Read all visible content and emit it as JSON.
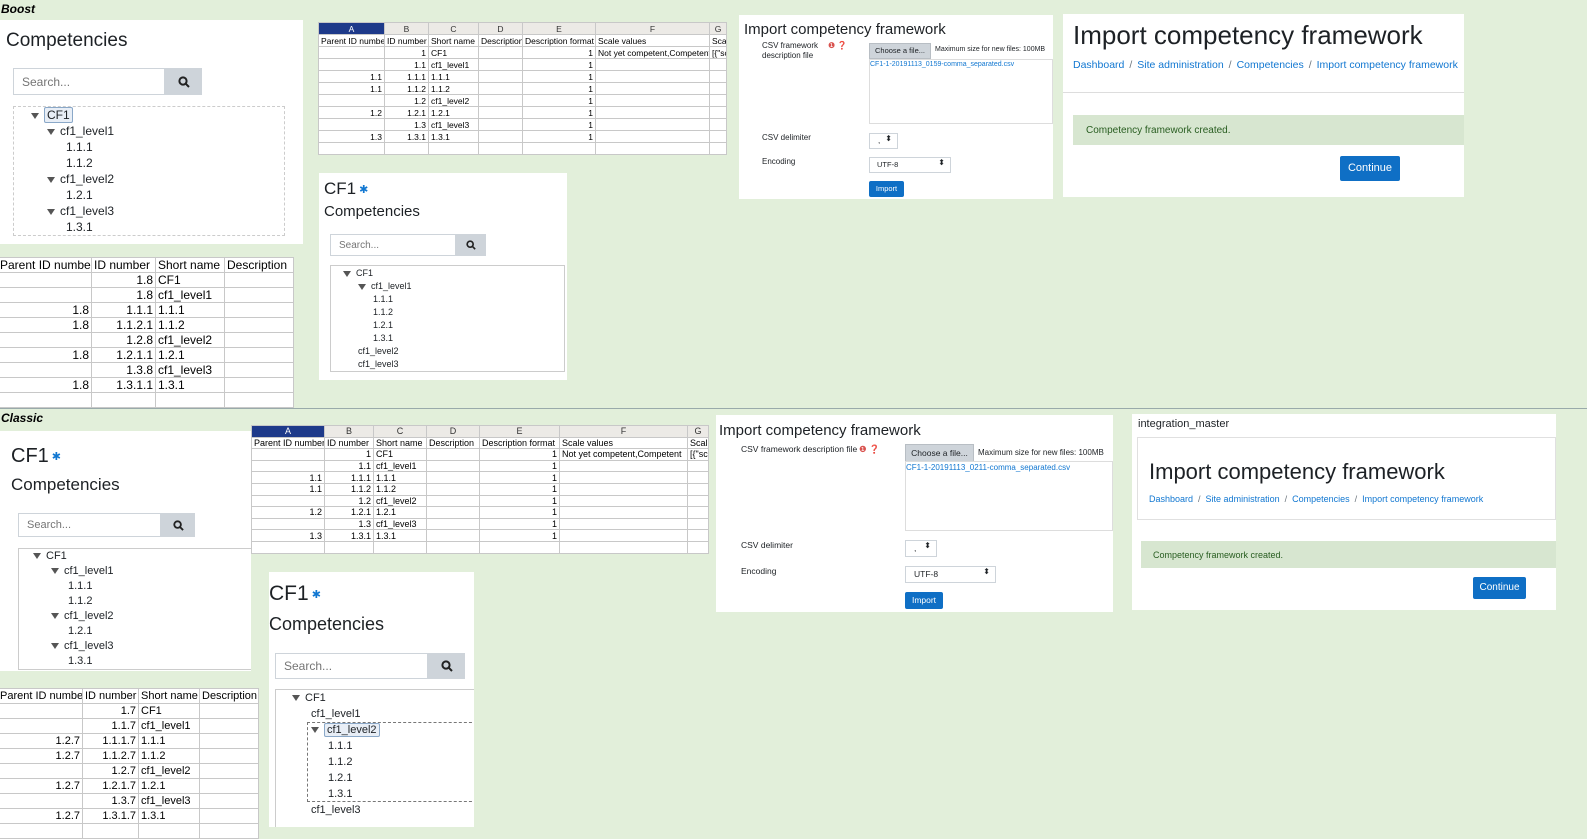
{
  "themes": {
    "boost": "Boost",
    "classic": "Classic"
  },
  "search_placeholder": "Search...",
  "icons": {
    "search": "search-icon",
    "gear": "gear-icon",
    "collapse": "caret-down-icon"
  },
  "boost_tree": {
    "title": "Competencies",
    "nodes": [
      "CF1",
      "cf1_level1",
      "1.1.1",
      "1.1.2",
      "cf1_level2",
      "1.2.1",
      "cf1_level3",
      "1.3.1"
    ]
  },
  "boost_tree2": {
    "framework": "CF1",
    "title": "Competencies",
    "nodes": [
      "CF1",
      "cf1_level1",
      "1.1.1",
      "1.1.2",
      "1.2.1",
      "1.3.1",
      "cf1_level2",
      "cf1_level3"
    ]
  },
  "classic_tree": {
    "framework": "CF1",
    "title": "Competencies",
    "nodes": [
      "CF1",
      "cf1_level1",
      "1.1.1",
      "1.1.2",
      "cf1_level2",
      "1.2.1",
      "cf1_level3",
      "1.3.1"
    ]
  },
  "classic_tree2": {
    "framework": "CF1",
    "title": "Competencies",
    "nodes": [
      "CF1",
      "cf1_level1",
      "cf1_level2",
      "1.1.1",
      "1.1.2",
      "1.2.1",
      "1.3.1",
      "cf1_level3"
    ]
  },
  "sheet_boost": {
    "col_letters": [
      "A",
      "B",
      "C",
      "D",
      "E",
      "F",
      "G"
    ],
    "headers": [
      "Parent ID number",
      "ID number",
      "Short name",
      "Description",
      "Description format",
      "Scale values",
      "Scal"
    ],
    "rows": [
      [
        "",
        "1",
        "CF1",
        "",
        "1",
        "Not yet competent,Competent",
        "[{\"sc"
      ],
      [
        "",
        "1.1",
        "cf1_level1",
        "",
        "1",
        "",
        ""
      ],
      [
        "1.1",
        "1.1.1",
        "1.1.1",
        "",
        "1",
        "",
        ""
      ],
      [
        "1.1",
        "1.1.2",
        "1.1.2",
        "",
        "1",
        "",
        ""
      ],
      [
        "",
        "1.2",
        "cf1_level2",
        "",
        "1",
        "",
        ""
      ],
      [
        "1.2",
        "1.2.1",
        "1.2.1",
        "",
        "1",
        "",
        ""
      ],
      [
        "",
        "1.3",
        "cf1_level3",
        "",
        "1",
        "",
        ""
      ],
      [
        "1.3",
        "1.3.1",
        "1.3.1",
        "",
        "1",
        "",
        ""
      ]
    ]
  },
  "sheet_classic": {
    "col_letters": [
      "A",
      "B",
      "C",
      "D",
      "E",
      "F",
      "G"
    ],
    "headers": [
      "Parent ID number",
      "ID number",
      "Short name",
      "Description",
      "Description format",
      "Scale values",
      "Scal"
    ],
    "rows": [
      [
        "",
        "1",
        "CF1",
        "",
        "1",
        "Not yet competent,Competent",
        "[{\"sc"
      ],
      [
        "",
        "1.1",
        "cf1_level1",
        "",
        "1",
        "",
        ""
      ],
      [
        "1.1",
        "1.1.1",
        "1.1.1",
        "",
        "1",
        "",
        ""
      ],
      [
        "1.1",
        "1.1.2",
        "1.1.2",
        "",
        "1",
        "",
        ""
      ],
      [
        "",
        "1.2",
        "cf1_level2",
        "",
        "1",
        "",
        ""
      ],
      [
        "1.2",
        "1.2.1",
        "1.2.1",
        "",
        "1",
        "",
        ""
      ],
      [
        "",
        "1.3",
        "cf1_level3",
        "",
        "1",
        "",
        ""
      ],
      [
        "1.3",
        "1.3.1",
        "1.3.1",
        "",
        "1",
        "",
        ""
      ]
    ]
  },
  "export_boost": {
    "headers": [
      "Parent ID number",
      "ID number",
      "Short name",
      "Description"
    ],
    "rows": [
      [
        "",
        "1.8",
        "CF1",
        ""
      ],
      [
        "",
        "1.8",
        "cf1_level1",
        ""
      ],
      [
        "1.8",
        "1.1.1",
        "1.1.1",
        ""
      ],
      [
        "1.8",
        "1.1.2.1",
        "1.1.2",
        ""
      ],
      [
        "",
        "1.2.8",
        "cf1_level2",
        ""
      ],
      [
        "1.8",
        "1.2.1.1",
        "1.2.1",
        ""
      ],
      [
        "",
        "1.3.8",
        "cf1_level3",
        ""
      ],
      [
        "1.8",
        "1.3.1.1",
        "1.3.1",
        ""
      ]
    ]
  },
  "export_classic": {
    "headers": [
      "Parent ID number",
      "ID number",
      "Short name",
      "Description"
    ],
    "rows": [
      [
        "",
        "1.7",
        "CF1",
        ""
      ],
      [
        "",
        "1.1.7",
        "cf1_level1",
        ""
      ],
      [
        "1.2.7",
        "1.1.1.7",
        "1.1.1",
        ""
      ],
      [
        "1.2.7",
        "1.1.2.7",
        "1.1.2",
        ""
      ],
      [
        "",
        "1.2.7",
        "cf1_level2",
        ""
      ],
      [
        "1.2.7",
        "1.2.1.7",
        "1.2.1",
        ""
      ],
      [
        "",
        "1.3.7",
        "cf1_level3",
        ""
      ],
      [
        "1.2.7",
        "1.3.1.7",
        "1.3.1",
        ""
      ]
    ]
  },
  "import_form_boost": {
    "title": "Import competency framework",
    "file_label": "CSV framework description file",
    "choose_label": "Choose a file...",
    "max_size": "Maximum size for new files: 100MB",
    "file_name": "CF1-1-20191113_0159-comma_separated.csv",
    "delimiter_label": "CSV delimiter",
    "delimiter_value": ",",
    "encoding_label": "Encoding",
    "encoding_value": "UTF-8",
    "import_label": "Import"
  },
  "import_form_classic": {
    "title": "Import competency framework",
    "file_label": "CSV framework description file",
    "choose_label": "Choose a file...",
    "max_size": "Maximum size for new files: 100MB",
    "file_name": "CF1-1-20191113_0211-comma_separated.csv",
    "delimiter_label": "CSV delimiter",
    "delimiter_value": ",",
    "encoding_label": "Encoding",
    "encoding_value": "UTF-8",
    "import_label": "Import"
  },
  "result_boost": {
    "title": "Import competency framework",
    "breadcrumb": [
      "Dashboard",
      "Site administration",
      "Competencies",
      "Import competency framework"
    ],
    "message": "Competency framework created.",
    "continue_label": "Continue"
  },
  "result_classic": {
    "site_name": "integration_master",
    "title": "Import competency framework",
    "breadcrumb": [
      "Dashboard",
      "Site administration",
      "Competencies",
      "Import competency framework"
    ],
    "message": "Competency framework created.",
    "continue_label": "Continue"
  }
}
